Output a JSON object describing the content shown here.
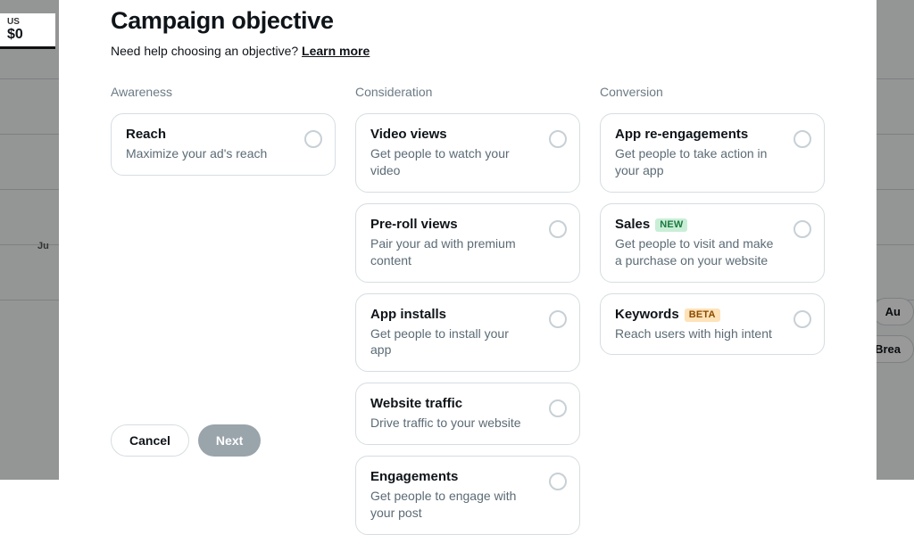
{
  "background": {
    "currency_prefix": "US",
    "amount": "$0",
    "axis_label": "Ju",
    "pill_au": "Au",
    "pill_brea": "Brea"
  },
  "modal": {
    "title": "Campaign objective",
    "help_text": "Need help choosing an objective? ",
    "help_link": "Learn more"
  },
  "columns": {
    "awareness": {
      "heading": "Awareness",
      "items": [
        {
          "title": "Reach",
          "desc": "Maximize your ad's reach"
        }
      ]
    },
    "consideration": {
      "heading": "Consideration",
      "items": [
        {
          "title": "Video views",
          "desc": "Get people to watch your video"
        },
        {
          "title": "Pre-roll views",
          "desc": "Pair your ad with premium content"
        },
        {
          "title": "App installs",
          "desc": "Get people to install your app"
        },
        {
          "title": "Website traffic",
          "desc": "Drive traffic to your website"
        },
        {
          "title": "Engagements",
          "desc": "Get people to engage with your post"
        }
      ]
    },
    "conversion": {
      "heading": "Conversion",
      "items": [
        {
          "title": "App re-engagements",
          "desc": "Get people to take action in your app",
          "badge": null
        },
        {
          "title": "Sales",
          "desc": "Get people to visit and make a purchase on your website",
          "badge": "NEW"
        },
        {
          "title": "Keywords",
          "desc": "Reach users with high intent",
          "badge": "BETA"
        }
      ]
    }
  },
  "footer": {
    "cancel": "Cancel",
    "next": "Next"
  }
}
